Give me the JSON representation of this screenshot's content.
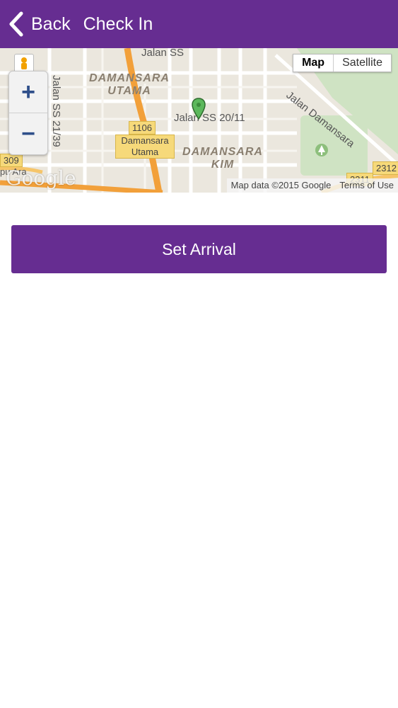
{
  "header": {
    "back_label": "Back",
    "title": "Check In",
    "bg_color": "#662d91"
  },
  "map": {
    "type_buttons": {
      "map": "Map",
      "satellite": "Satellite",
      "selected": "Map"
    },
    "zoom_in": "+",
    "zoom_out": "−",
    "area_labels": {
      "damansara_utama": "DAMANSARA UTAMA",
      "damansara_kim": "DAMANSARA KIM"
    },
    "road_labels": {
      "jalan_ss_top": "Jalan SS",
      "jalan_ss_21_39": "Jalan SS 21/39",
      "jalan_ss_20_11": "Jalan SS 20/11",
      "jalan_damansara": "Jalan Damansara",
      "pu_ara": "pu Ara"
    },
    "shields": {
      "s1106": "1106",
      "damansara_utama": "Damansara Utama",
      "s2312": "2312",
      "s2311": "2311",
      "s309": "309"
    },
    "logo": "Google",
    "attribution": "Map data ©2015 Google",
    "terms": "Terms of Use",
    "marker_color": "#5cb85c"
  },
  "actions": {
    "set_arrival_label": "Set Arrival",
    "button_color": "#662d91"
  }
}
